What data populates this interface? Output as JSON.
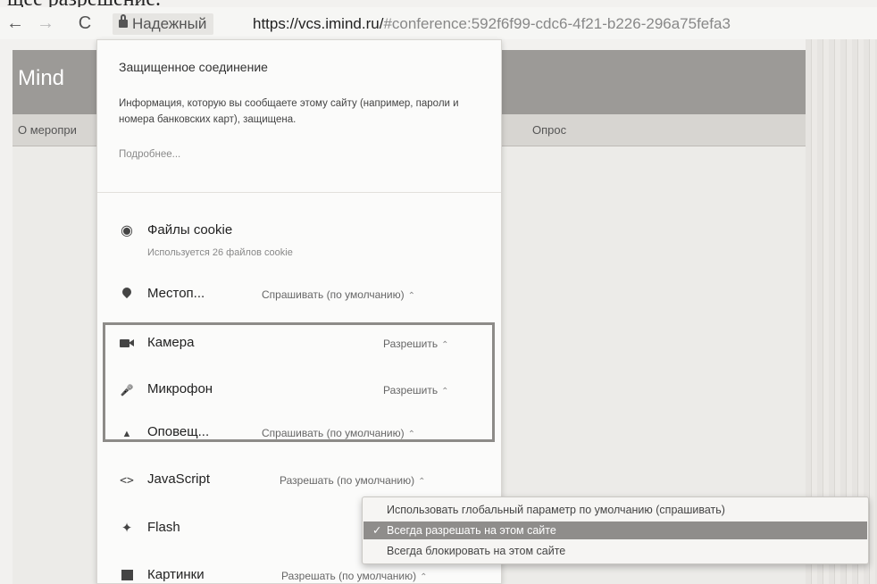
{
  "caption": "щее разрешение.",
  "toolbar": {
    "back_icon": "←",
    "forward_icon": "→",
    "reload_icon": "C",
    "secure_label": "Надежный",
    "url_host": "https://vcs.imind.ru/",
    "url_rest": "#conference:592f6f99-cdc6-4f21-b226-296a75fefa3"
  },
  "page": {
    "logo": "Mind",
    "tab_partial": "О меропри",
    "tab_poll": "Опрос"
  },
  "popup": {
    "title": "Защищенное соединение",
    "description": "Информация, которую вы сообщаете этому сайту (например, пароли и номера банковских карт), защищена.",
    "more_link": "Подробнее...",
    "cookies": {
      "label": "Файлы cookie",
      "sub": "Используется 26 файлов cookie"
    },
    "permissions": [
      {
        "id": "location",
        "label": "Местоп...",
        "value": "Спрашивать (по умолчанию)"
      },
      {
        "id": "camera",
        "label": "Камера",
        "value": "Разрешить"
      },
      {
        "id": "microphone",
        "label": "Микрофон",
        "value": "Разрешить"
      },
      {
        "id": "notifications",
        "label": "Оповещ...",
        "value": "Спрашивать (по умолчанию)"
      },
      {
        "id": "javascript",
        "label": "JavaScript",
        "value": "Разрешать (по умолчанию)"
      },
      {
        "id": "flash",
        "label": "Flash",
        "value": ""
      },
      {
        "id": "images",
        "label": "Картинки",
        "value": "Разрешать (по умолчанию)"
      }
    ],
    "spinner": "⌃"
  },
  "dropdown": {
    "options": [
      "Использовать глобальный параметр по умолчанию (спрашивать)",
      "Всегда разрешать на этом сайте",
      "Всегда блокировать на этом сайте"
    ],
    "selected_index": 1,
    "check": "✓"
  },
  "colors": {
    "header_bg": "#9c9a97",
    "highlight": "#8d8b88",
    "selected_option": "#8f8d8b"
  }
}
